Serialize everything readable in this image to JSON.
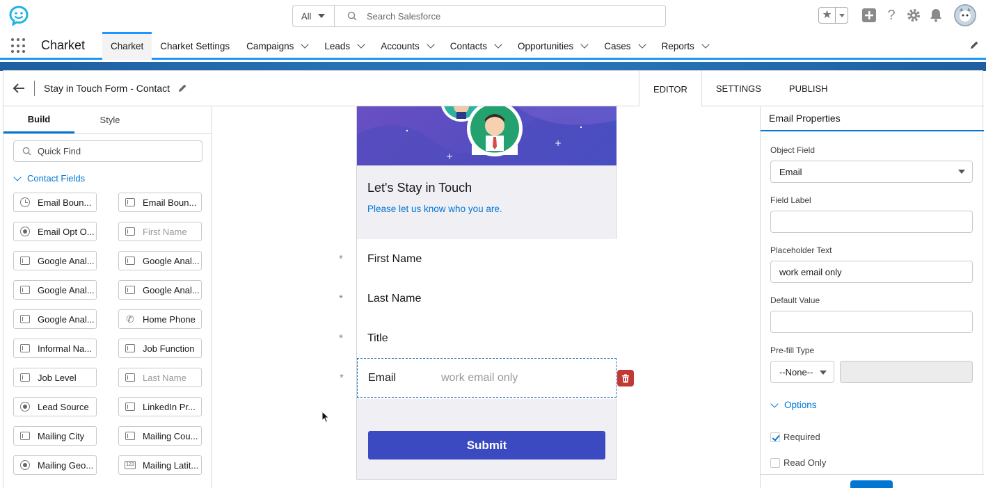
{
  "header": {
    "search_scope": "All",
    "search_placeholder": "Search Salesforce"
  },
  "nav": {
    "app_name": "Charket",
    "items": [
      {
        "label": "Charket",
        "active": true,
        "menu": false
      },
      {
        "label": "Charket Settings",
        "active": false,
        "menu": false
      },
      {
        "label": "Campaigns",
        "active": false,
        "menu": true
      },
      {
        "label": "Leads",
        "active": false,
        "menu": true
      },
      {
        "label": "Accounts",
        "active": false,
        "menu": true
      },
      {
        "label": "Contacts",
        "active": false,
        "menu": true
      },
      {
        "label": "Opportunities",
        "active": false,
        "menu": true
      },
      {
        "label": "Cases",
        "active": false,
        "menu": true
      },
      {
        "label": "Reports",
        "active": false,
        "menu": true
      }
    ]
  },
  "builder": {
    "title": "Stay in Touch Form - Contact",
    "tabs": [
      "EDITOR",
      "SETTINGS",
      "PUBLISH"
    ],
    "active_tab": "EDITOR"
  },
  "left_panel": {
    "tabs": [
      "Build",
      "Style"
    ],
    "quick_find_placeholder": "Quick Find",
    "section_label": "Contact Fields",
    "fields": [
      {
        "label": "Email Boun...",
        "icon": "clock-icon",
        "disabled": false
      },
      {
        "label": "Email Boun...",
        "icon": "text-field-icon",
        "disabled": false
      },
      {
        "label": "Email Opt O...",
        "icon": "radio-icon",
        "disabled": false
      },
      {
        "label": "First Name",
        "icon": "text-field-icon",
        "disabled": true
      },
      {
        "label": "Google Anal...",
        "icon": "text-field-icon",
        "disabled": false
      },
      {
        "label": "Google Anal...",
        "icon": "text-field-icon",
        "disabled": false
      },
      {
        "label": "Google Anal...",
        "icon": "text-field-icon",
        "disabled": false
      },
      {
        "label": "Google Anal...",
        "icon": "text-field-icon",
        "disabled": false
      },
      {
        "label": "Google Anal...",
        "icon": "text-field-icon",
        "disabled": false
      },
      {
        "label": "Home Phone",
        "icon": "phone-icon",
        "disabled": false
      },
      {
        "label": "Informal Na...",
        "icon": "text-field-icon",
        "disabled": false
      },
      {
        "label": "Job Function",
        "icon": "text-field-icon",
        "disabled": false
      },
      {
        "label": "Job Level",
        "icon": "text-field-icon",
        "disabled": false
      },
      {
        "label": "Last Name",
        "icon": "text-field-icon",
        "disabled": true
      },
      {
        "label": "Lead Source",
        "icon": "radio-icon",
        "disabled": false
      },
      {
        "label": "LinkedIn Pr...",
        "icon": "text-field-icon",
        "disabled": false
      },
      {
        "label": "Mailing City",
        "icon": "text-field-icon",
        "disabled": false
      },
      {
        "label": "Mailing Cou...",
        "icon": "text-field-icon",
        "disabled": false
      },
      {
        "label": "Mailing Geo...",
        "icon": "radio-icon",
        "disabled": false
      },
      {
        "label": "Mailing Latit...",
        "icon": "number-icon",
        "disabled": false
      }
    ]
  },
  "form": {
    "heading": "Let's Stay in Touch",
    "subheading": "Please let us know who you are.",
    "required_mark": "*",
    "fields": [
      {
        "label": "First Name",
        "placeholder": ""
      },
      {
        "label": "Last Name",
        "placeholder": ""
      },
      {
        "label": "Title",
        "placeholder": ""
      },
      {
        "label": "Email",
        "placeholder": "work email only"
      }
    ],
    "submit_label": "Submit"
  },
  "properties": {
    "title": "Email Properties",
    "object_field_label": "Object Field",
    "object_field_value": "Email",
    "field_label_label": "Field Label",
    "field_label_value": "",
    "placeholder_label": "Placeholder Text",
    "placeholder_value": "work email only",
    "default_value_label": "Default Value",
    "default_value_value": "",
    "prefill_label": "Pre-fill Type",
    "prefill_value": "--None--",
    "options_label": "Options",
    "required_label": "Required",
    "required_checked": true,
    "readonly_label": "Read Only",
    "readonly_checked": false
  },
  "colors": {
    "brand_blue": "#0176d3",
    "submit_button": "#3b4ac0",
    "delete_button": "#c23934",
    "hero_purple": "#5a4ec0"
  }
}
